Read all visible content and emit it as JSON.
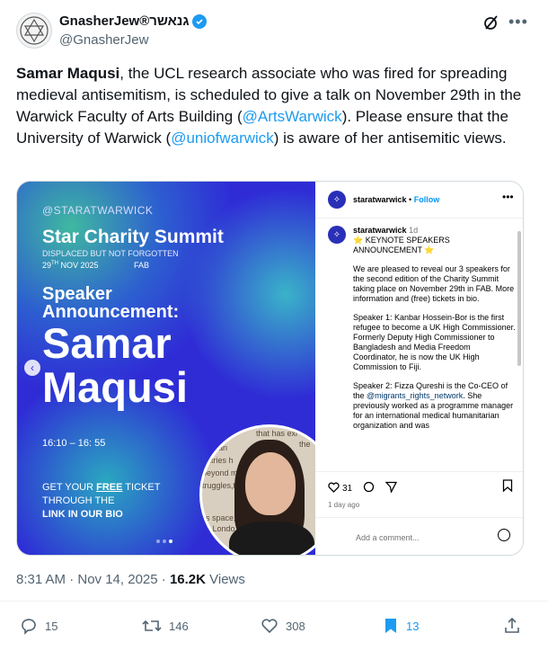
{
  "author": {
    "display_name": "GnasherJew®גנאשר",
    "handle": "@GnasherJew"
  },
  "tweet": {
    "name_bold": "Samar Maqusi",
    "part1": ", the UCL research associate who was fired for spreading medieval antisemitism, is scheduled to give a talk on November 29th in the Warwick Faculty of Arts Building (",
    "mention1": "@ArtsWarwick",
    "part2": "). Please ensure that the University of Warwick (",
    "mention2": "@uniofwarwick",
    "part3": ") is aware of her antisemitic views."
  },
  "poster": {
    "handle": "@STARATWARWICK",
    "summit": "Star Charity Summit",
    "subtitle": "DISPLACED BUT NOT FORGOTTEN",
    "date_day": "29",
    "date_suffix": "TH",
    "date_rest": " NOV 2025",
    "venue": "FAB",
    "speaker_line1": "Speaker",
    "speaker_line2": "Announcement:",
    "name_line1": "Samar",
    "name_line2": "Maqusi",
    "time": "16:10 – 16: 55",
    "ticket_pre": "GET YOUR ",
    "ticket_free": "FREE",
    "ticket_post": " TICKET",
    "ticket_line2": "THROUGH THE",
    "ticket_line3": "LINK IN OUR BIO",
    "photo_text1": "that has exi",
    "photo_text2": "stinian",
    "photo_text3": "the",
    "photo_text4": "untries h",
    "photo_text5": "beyond m",
    "photo_text6": "truggles,th",
    "photo_text7": "s space, is",
    "photo_text8": "d Londo",
    "photo_text9": "tell"
  },
  "instagram": {
    "username": "staratwarwick",
    "follow": "Follow",
    "dot": " • ",
    "cap_user": "staratwarwick",
    "cap_time": "1d",
    "cap_head": "⭐ KEYNOTE SPEAKERS ANNOUNCEMENT ⭐",
    "cap_p1": "We are pleased to reveal our 3 speakers for the second edition of the Charity Summit taking place on November 29th in FAB. More information and (free) tickets in bio.",
    "cap_p2": "Speaker 1: Kanbar Hossein-Bor is the first refugee to become a UK High Commissioner. Formerly Deputy High Commissioner to Bangladesh and Media Freedom Coordinator, he is now the UK High Commission to Fiji.",
    "cap_p3a": "Speaker 2: Fizza Qureshi is the Co-CEO of the ",
    "cap_p3_mention": "@migrants_rights_network",
    "cap_p3b": ". She previously worked as a programme manager for an international medical humanitarian organization and was",
    "likes": "31",
    "ago": "1 day ago",
    "add_comment": "Add a comment..."
  },
  "meta": {
    "time": "8:31 AM · Nov 14, 2025 · ",
    "views_count": "16.2K",
    "views_label": " Views"
  },
  "actions": {
    "replies": "15",
    "reposts": "146",
    "likes": "308",
    "bookmarks": "13"
  },
  "colors": {
    "accent": "#1d9bf0",
    "poster_bg": "#2f2cd6"
  }
}
